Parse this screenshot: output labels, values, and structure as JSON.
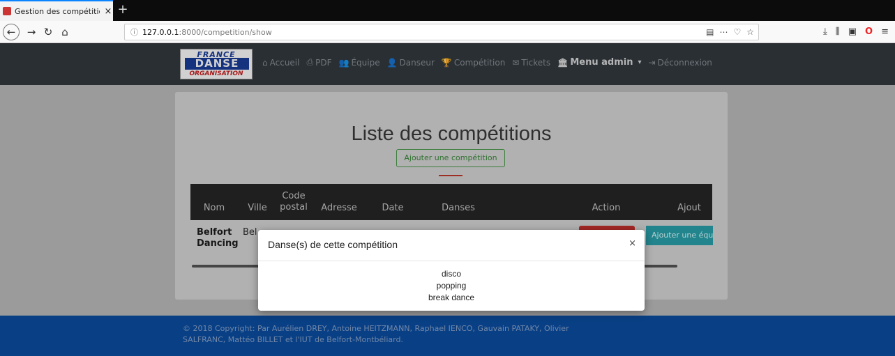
{
  "browser": {
    "tab_title": "Gestion des compétition",
    "tab_close": "×",
    "new_tab": "+",
    "url_host": "127.0.0.1",
    "url_path": ":8000/competition/show",
    "url_info": "ⓘ"
  },
  "nav": {
    "logo_top": "FRANCE",
    "logo_main": "DANSE",
    "logo_bottom": "ORGANISATION",
    "items": [
      {
        "icon": "home-icon",
        "glyph": "⌂",
        "label": "Accueil"
      },
      {
        "icon": "print-icon",
        "glyph": "⎙",
        "label": "PDF"
      },
      {
        "icon": "users-icon",
        "glyph": "👥",
        "label": "Équipe"
      },
      {
        "icon": "user-icon",
        "glyph": "👤",
        "label": "Danseur"
      },
      {
        "icon": "trophy-icon",
        "glyph": "🏆",
        "label": "Compétition"
      },
      {
        "icon": "envelope-icon",
        "glyph": "✉",
        "label": "Tickets"
      },
      {
        "icon": "bank-icon",
        "glyph": "🏛",
        "label": "Menu admin"
      },
      {
        "icon": "logout-icon",
        "glyph": "⇥",
        "label": "Déconnexion"
      }
    ],
    "admin_caret": "▾"
  },
  "main": {
    "title": "Liste des compétitions",
    "add_button": "Ajouter une compétition",
    "columns": [
      "Nom",
      "Ville",
      "Code postal",
      "Adresse",
      "Date",
      "Danses",
      "Action",
      "Ajout"
    ],
    "row": {
      "name_line1": "Belfort",
      "name_line2": "Dancing",
      "city": "Bel",
      "add_team": "Ajouter une équ"
    }
  },
  "modal": {
    "title": "Danse(s) de cette compétition",
    "close": "×",
    "dances": [
      "disco",
      "popping",
      "break dance"
    ]
  },
  "footer": {
    "line1": "© 2018 Copyright: Par Aurélien DREY, Antoine HEITZMANN, Raphael IENCO, Gauvain PATAKY, Olivier",
    "line2": "SALFRANC, Mattéo BILLET et l'IUT de Belfort-Montbéliard."
  },
  "colors": {
    "navbar": "#343a40",
    "footer": "#0b4fa3",
    "accent_teal": "#2aa1ad",
    "danger": "#c0392b",
    "success": "#3a8a3a"
  }
}
